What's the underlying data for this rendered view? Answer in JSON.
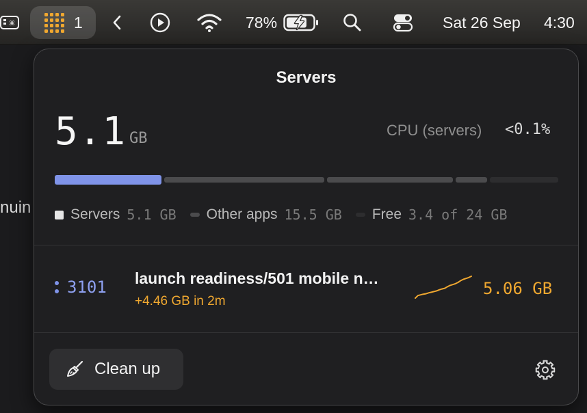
{
  "menubar": {
    "app_badge": "1",
    "battery_percent": "78%",
    "battery_level": 0.78,
    "date": "Sat 26 Sep",
    "time": "4:30"
  },
  "background": {
    "fragment_text": "nuin"
  },
  "popover": {
    "title": "Servers",
    "memory": {
      "value": "5.1",
      "unit": "GB"
    },
    "cpu": {
      "label": "CPU (servers)",
      "value": "<0.1%"
    },
    "memory_bar": {
      "total_gb": 24,
      "servers_gb": 5.1,
      "other_gb": 15.5,
      "free_gb": 3.4,
      "colors": {
        "servers": "#7f93e8",
        "other": "#4b4b4d",
        "free": "#2d2d2f"
      }
    },
    "legend": [
      {
        "label": "Servers",
        "value": "5.1 GB",
        "color": "#e6e6e6"
      },
      {
        "label": "Other apps",
        "value": "15.5 GB",
        "color": "#4b4b4d"
      },
      {
        "label": "Free",
        "value": "3.4 of 24 GB",
        "color": "#2d2d2f"
      }
    ],
    "server": {
      "port": "3101",
      "name": "launch readiness/501 mobile n…",
      "delta": "+4.46 GB in 2m",
      "memory": "5.06 GB",
      "accent": "#f0a830",
      "sparkline": [
        0.0,
        0.12,
        0.15,
        0.18,
        0.2,
        0.24,
        0.27,
        0.3,
        0.33,
        0.38,
        0.42,
        0.45,
        0.52,
        0.58,
        0.62,
        0.66,
        0.72,
        0.8,
        0.86,
        0.9,
        0.94,
        1.0
      ]
    },
    "footer": {
      "cleanup_label": "Clean up",
      "cleanup_icon": "broom-icon",
      "settings_icon": "gear-icon"
    }
  }
}
